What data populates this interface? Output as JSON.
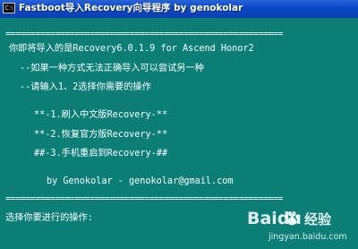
{
  "window": {
    "icon_text": "C:\\",
    "title": "Fastboot导入Recovery向导程序 by genokolar"
  },
  "console": {
    "separator_top": "========================================================",
    "line_target": "你即将导入的是Recovery6.0.1.9 for Ascend Honor2",
    "line_hint1": "--如果一种方式无法正确导入可以尝试另一种",
    "line_hint2": "--请输入1、2选择你需要的操作",
    "option1": "**-1.刷入中文版Recovery-**",
    "option2": "**-2.恢复官方版Recovery-**",
    "option3": "##-3.手机重启到Recovery-##",
    "credit": "by Genokolar - genokolar@gmail.com",
    "separator_bottom": "========================================================",
    "prompt": "选择你要进行的操作:"
  },
  "watermark": {
    "brand": "Baidu",
    "name": "经验",
    "url": "jingyan.baidu.com"
  }
}
